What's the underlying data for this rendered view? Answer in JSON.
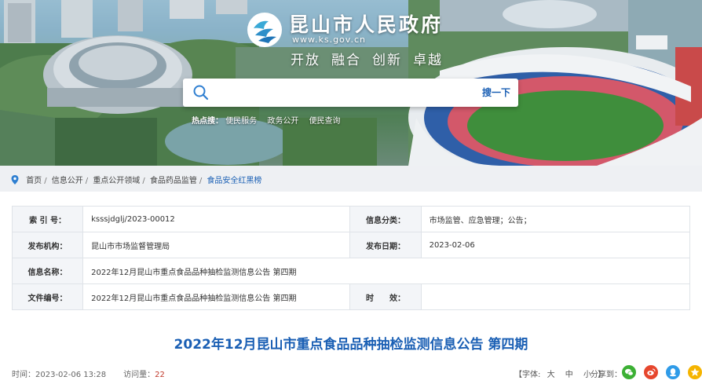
{
  "header": {
    "site_title": "昆山市人民政府",
    "site_domain": "www.ks.gov.cn",
    "slogan": [
      "开放",
      "融合",
      "创新",
      "卓越"
    ],
    "search": {
      "placeholder": "",
      "button_label": "搜一下"
    },
    "hot_search": {
      "label": "热点搜：",
      "links": [
        "便民服务",
        "政务公开",
        "便民查询"
      ]
    }
  },
  "breadcrumb": {
    "items": [
      "首页",
      "信息公开",
      "重点公开领域",
      "食品药品监管",
      "食品安全红黑榜"
    ]
  },
  "info_table": {
    "row1": {
      "label1": "索 引 号：",
      "value1": "ksssjdglj/2023-00012",
      "label2": "信息分类：",
      "value2": "市场监管、应急管理；公告；"
    },
    "row2": {
      "label1": "发布机构：",
      "value1": "昆山市市场监督管理局",
      "label2": "发布日期：",
      "value2": "2023-02-06"
    },
    "row3": {
      "label1": "信息名称：",
      "value1": "2022年12月昆山市重点食品品种抽检监测信息公告 第四期"
    },
    "row4": {
      "label1": "文件编号：",
      "value1": "2022年12月昆山市重点食品品种抽检监测信息公告 第四期",
      "label2": "时　　效：",
      "value2": ""
    }
  },
  "article": {
    "title": "2022年12月昆山市重点食品品种抽检监测信息公告 第四期",
    "time_label": "时间：",
    "time_value": "2023-02-06 13:28",
    "views_label": "访问量：",
    "views_value": "22"
  },
  "toolbar": {
    "font_label_open": "【字体:",
    "font_big": "大",
    "font_mid": "中",
    "font_small": "小",
    "font_label_close": "】",
    "share_label": "分享到："
  },
  "share_icons": [
    "wechat-icon",
    "weibo-icon",
    "qq-icon",
    "qzone-icon"
  ],
  "colors": {
    "accent": "#1a5fb4",
    "views": "#c0392b",
    "wechat": "#3cb034",
    "weibo": "#e6462d",
    "qq": "#2f9be8",
    "qzone": "#f5b400"
  }
}
